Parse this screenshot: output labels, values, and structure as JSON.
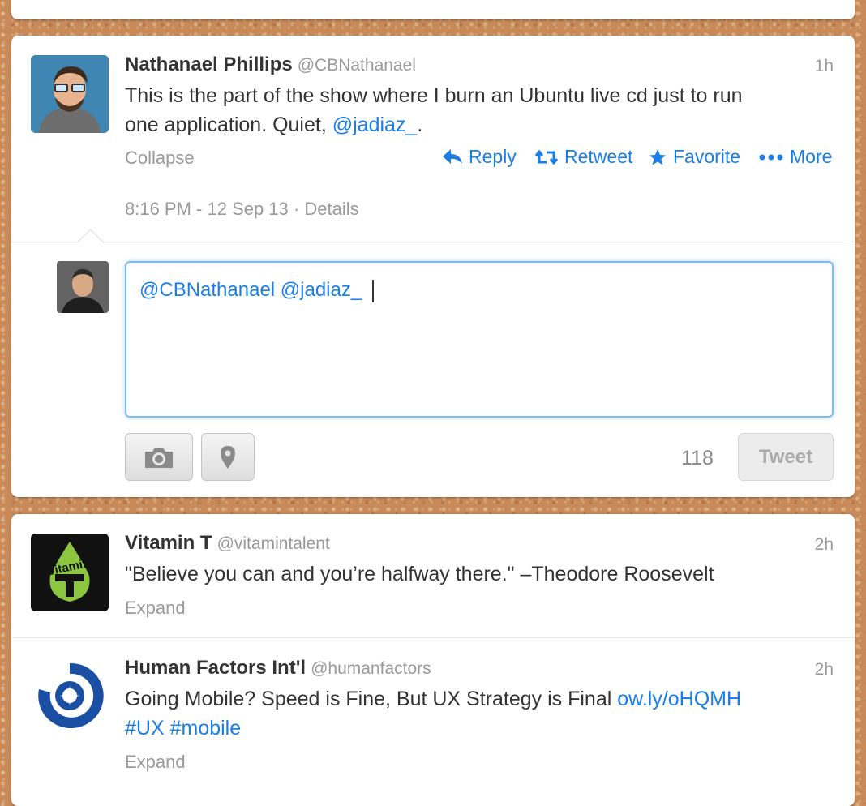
{
  "tweet_main": {
    "name": "Nathanael Phillips",
    "handle": "@CBNathanael",
    "time": "1h",
    "text_line1": "This is the part of the show where I burn an Ubuntu live cd just to run",
    "text_line2_before": "one application. Quiet, ",
    "text_line2_link": "@jadiaz_",
    "text_line2_after": ".",
    "collapse_label": "Collapse",
    "actions": {
      "reply": "Reply",
      "retweet": "Retweet",
      "favorite": "Favorite",
      "more": "More"
    },
    "timestamp": "8:16 PM - 12 Sep 13",
    "details_sep": " · ",
    "details_label": "Details"
  },
  "reply_box": {
    "text": "@CBNathanael @jadiaz_ ",
    "char_count": "118",
    "tweet_label": "Tweet"
  },
  "tweet_vitamin": {
    "name": "Vitamin T",
    "handle": "@vitamintalent",
    "time": "2h",
    "text": "\"Believe you can and you’re halfway there.\"  –Theodore Roosevelt",
    "expand_label": "Expand",
    "logo_text": "vitamin"
  },
  "tweet_hfi": {
    "name": "Human Factors Int'l",
    "handle": "@humanfactors",
    "time": "2h",
    "text_line1_before": "Going Mobile? Speed is Fine, But UX Strategy is Final ",
    "text_line1_link": "ow.ly/oHQMH",
    "hashtag1": "#UX",
    "hashtag2": "#mobile",
    "expand_label": "Expand"
  },
  "colors": {
    "link": "#1a7ee8",
    "muted": "#999999",
    "background_cork": "#c98a5a"
  }
}
